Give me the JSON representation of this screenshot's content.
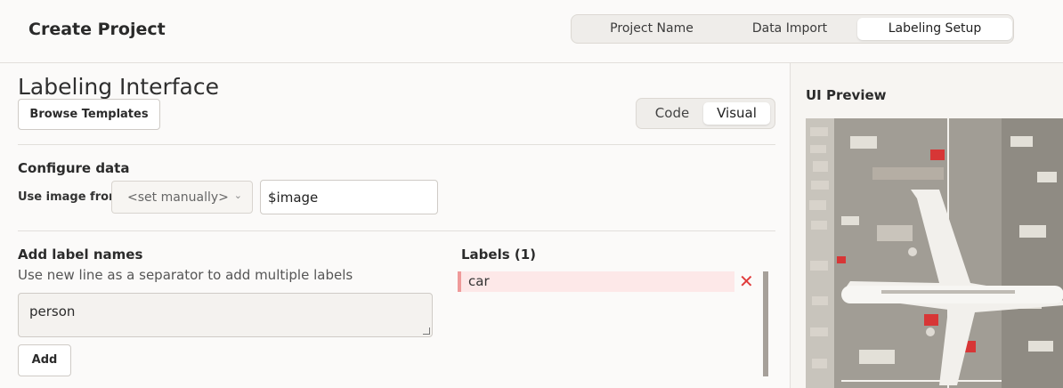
{
  "header": {
    "title": "Create Project",
    "steps": [
      {
        "label": "Project Name",
        "active": false
      },
      {
        "label": "Data Import",
        "active": false
      },
      {
        "label": "Labeling Setup",
        "active": true
      }
    ]
  },
  "main": {
    "title": "Labeling Interface",
    "browse_templates_label": "Browse Templates",
    "view_toggle": {
      "code_label": "Code",
      "visual_label": "Visual",
      "selected": "Visual"
    },
    "configure": {
      "title": "Configure data",
      "use_image_label": "Use image from",
      "select_value": "<set manually>",
      "image_input_value": "$image"
    },
    "add_labels": {
      "title": "Add label names",
      "hint": "Use new line as a separator to add multiple labels",
      "textarea_value": "person",
      "add_button_label": "Add"
    },
    "labels": {
      "title": "Labels (1)",
      "items": [
        {
          "name": "car",
          "color": "#ef9a9a"
        }
      ],
      "remove_icon": "close-icon"
    }
  },
  "preview": {
    "title": "UI Preview",
    "image_icon": "aerial-airport-image"
  },
  "colors": {
    "background": "#fbfaf9",
    "label_fill": "#fde8e8",
    "label_accent": "#ef9a9a",
    "remove_red": "#e03c3c"
  }
}
